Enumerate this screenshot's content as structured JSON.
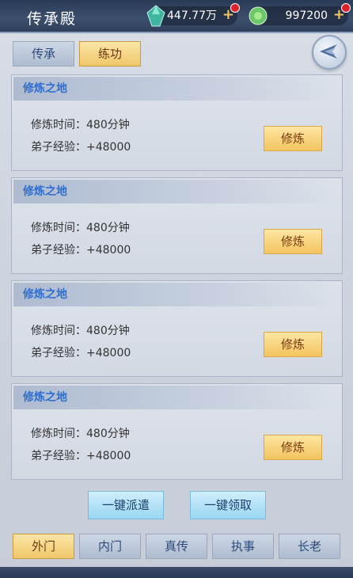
{
  "header": {
    "title": "传承殿",
    "gem_amount": "447.77万",
    "jade_amount": "997200",
    "plus": "+"
  },
  "tabs": [
    {
      "label": "传承",
      "active": false
    },
    {
      "label": "练功",
      "active": true
    }
  ],
  "cards": [
    {
      "title": "修炼之地",
      "time_label": "修炼时间：480分钟",
      "exp_label": "弟子经验：+48000",
      "button": "修炼"
    },
    {
      "title": "修炼之地",
      "time_label": "修炼时间：480分钟",
      "exp_label": "弟子经验：+48000",
      "button": "修炼"
    },
    {
      "title": "修炼之地",
      "time_label": "修炼时间：480分钟",
      "exp_label": "弟子经验：+48000",
      "button": "修炼"
    },
    {
      "title": "修炼之地",
      "time_label": "修炼时间：480分钟",
      "exp_label": "弟子经验：+48000",
      "button": "修炼"
    }
  ],
  "actions": {
    "dispatch_all": "一键派遣",
    "collect_all": "一键领取"
  },
  "bottom_tabs": [
    {
      "label": "外门",
      "active": true
    },
    {
      "label": "内门",
      "active": false
    },
    {
      "label": "真传",
      "active": false
    },
    {
      "label": "执事",
      "active": false
    },
    {
      "label": "长老",
      "active": false
    }
  ]
}
